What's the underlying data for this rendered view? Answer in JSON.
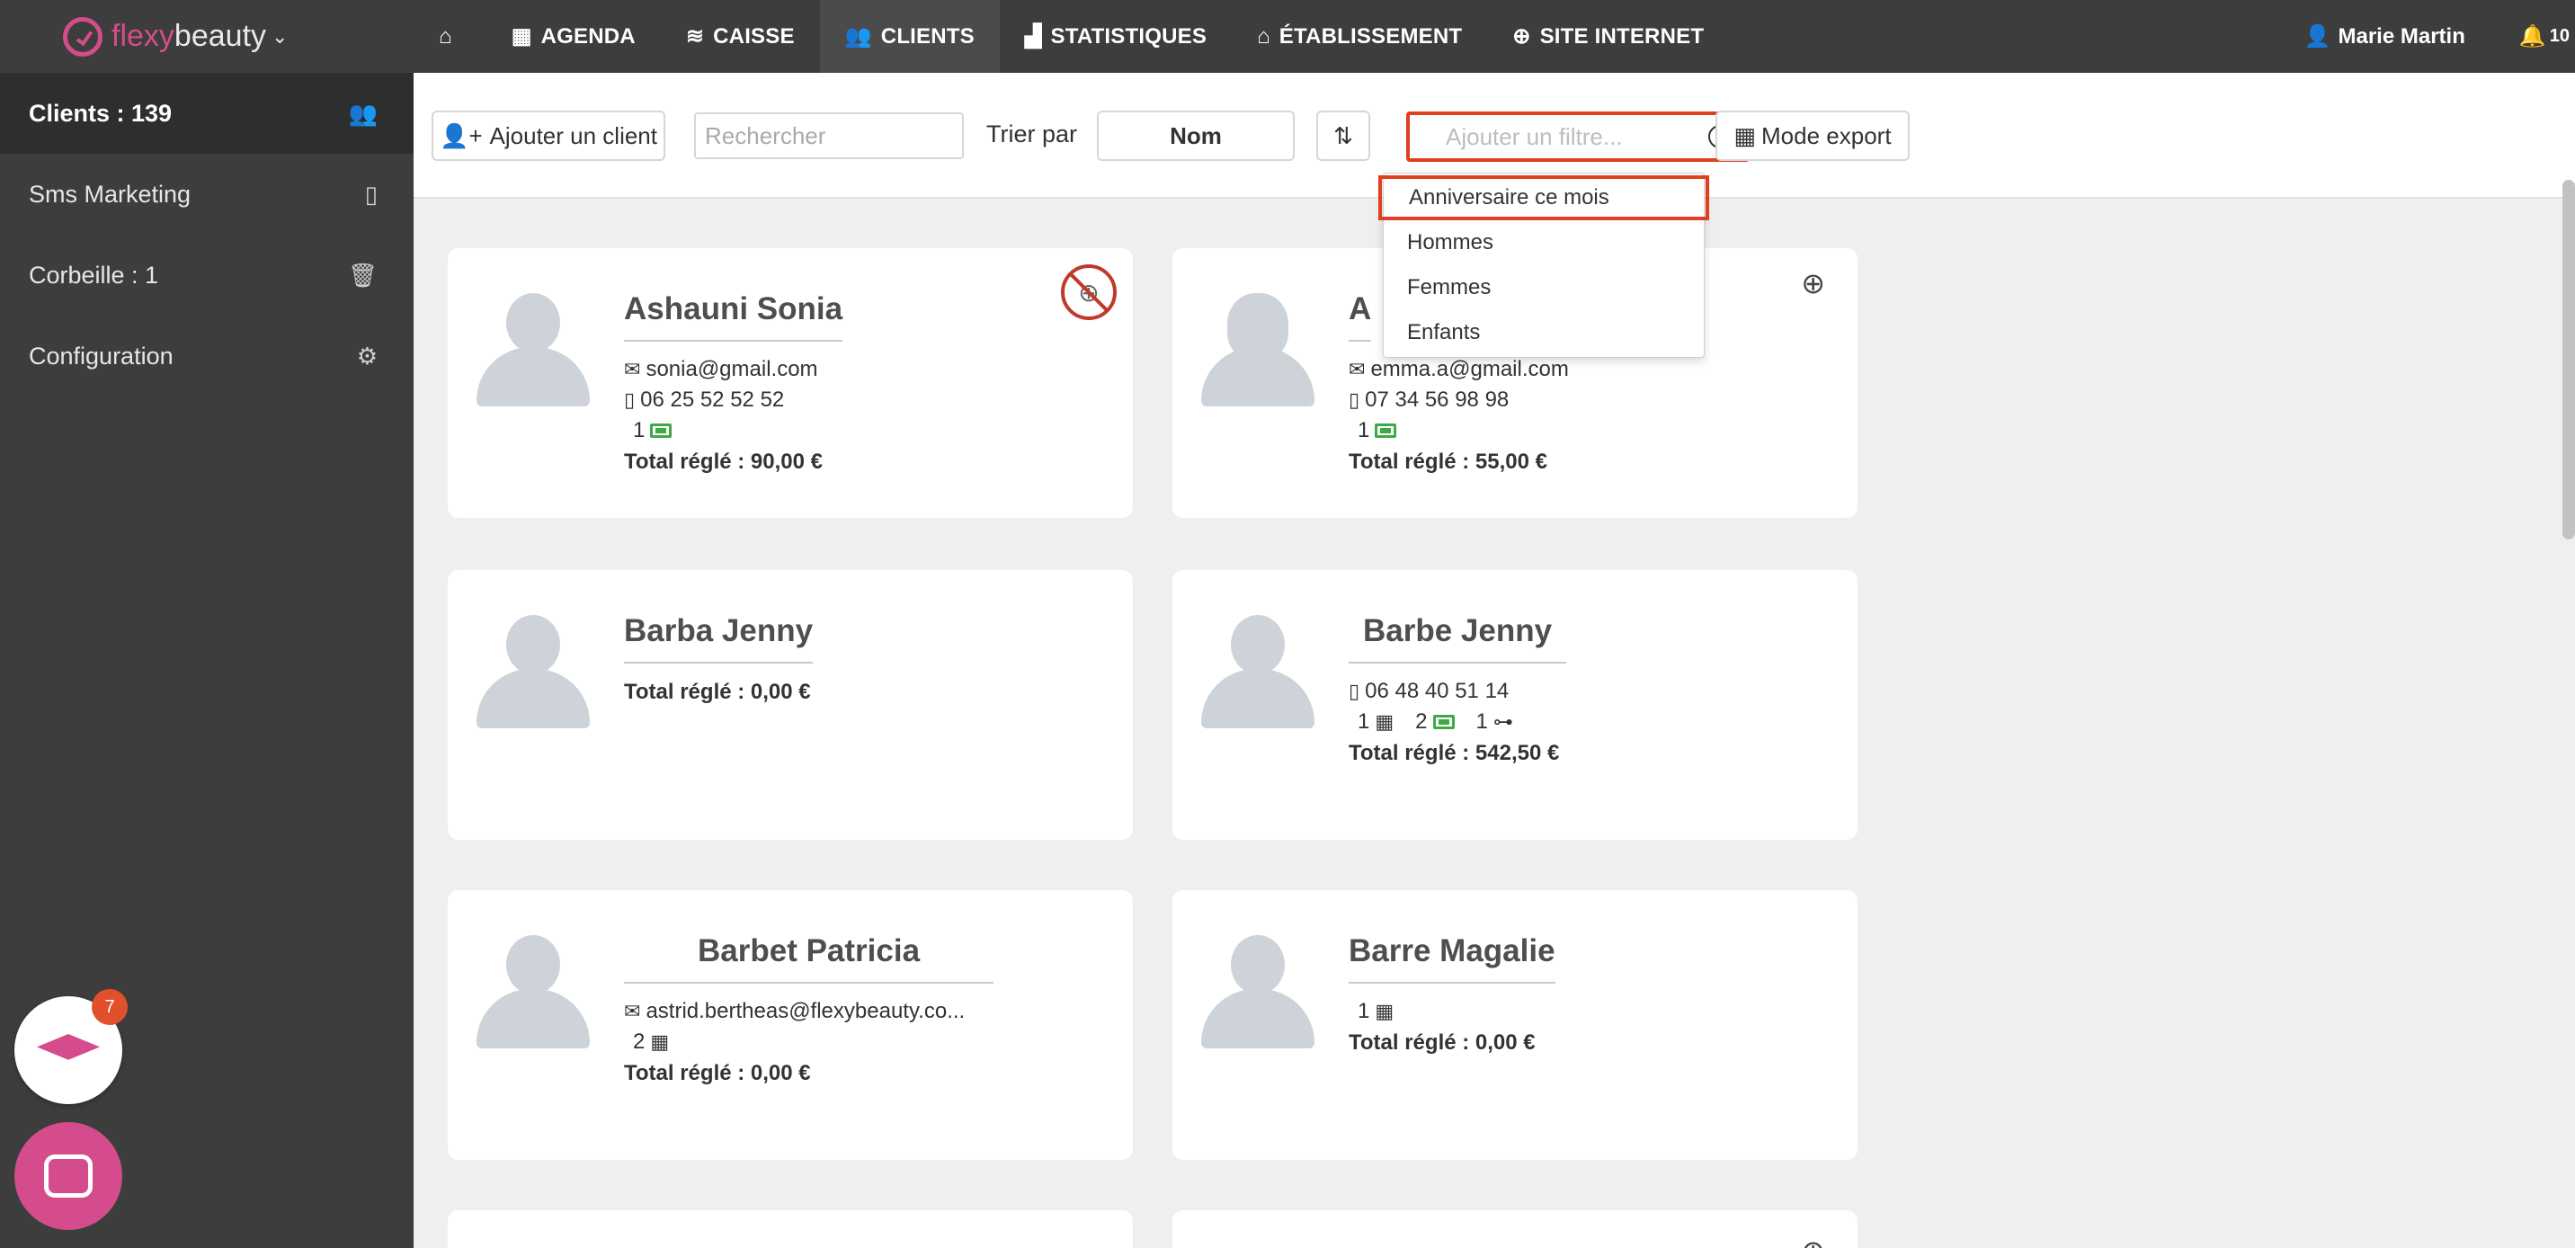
{
  "brand": {
    "part1": "flexy",
    "part2": "beauty"
  },
  "nav": {
    "items": [
      {
        "icon": "⌂",
        "label": ""
      },
      {
        "icon": "▦",
        "label": "AGENDA"
      },
      {
        "icon": "≋",
        "label": "CAISSE"
      },
      {
        "icon": "👥",
        "label": "CLIENTS"
      },
      {
        "icon": "▟",
        "label": "STATISTIQUES"
      },
      {
        "icon": "⌂",
        "label": "ÉTABLISSEMENT"
      },
      {
        "icon": "⊕",
        "label": "SITE INTERNET"
      }
    ],
    "user": "Marie Martin",
    "notifications": "10"
  },
  "sidebar": {
    "items": [
      {
        "label": "Clients : 139",
        "icon": "👥"
      },
      {
        "label": "Sms Marketing",
        "icon": "▯"
      },
      {
        "label": "Corbeille : 1",
        "icon": "🗑"
      },
      {
        "label": "Configuration",
        "icon": "⚙"
      }
    ],
    "academy_badge": "7"
  },
  "toolbar": {
    "add_client": "Ajouter un client",
    "search_placeholder": "Rechercher",
    "sort_label": "Trier par",
    "sort_value": "Nom",
    "filter_placeholder": "Ajouter un filtre...",
    "export": "Mode export"
  },
  "filter_options": [
    "Anniversaire ce mois",
    "Hommes",
    "Femmes",
    "Enfants"
  ],
  "clients": [
    {
      "name": "Ashauni Sonia",
      "email": "sonia@gmail.com",
      "phone": "06 25 52 52 52",
      "tickets": "1",
      "total": "Total réglé : 90,00 €"
    },
    {
      "name": "A",
      "email": "emma.a@gmail.com",
      "phone": "07 34 56 98 98",
      "tickets": "1",
      "total": "Total réglé : 55,00 €"
    },
    {
      "name": "Barba Jenny",
      "total": "Total réglé : 0,00 €"
    },
    {
      "name": "Barbe Jenny",
      "phone": "06 48 40 51 14",
      "appointments": "1",
      "tickets": "2",
      "referrals": "1",
      "total": "Total réglé : 542,50 €"
    },
    {
      "name": "Barbet Patricia",
      "email": "astrid.bertheas@flexybeauty.co...",
      "appointments": "2",
      "total": "Total réglé : 0,00 €"
    },
    {
      "name": "Barre Magalie",
      "appointments": "1",
      "total": "Total réglé : 0,00 €"
    }
  ]
}
